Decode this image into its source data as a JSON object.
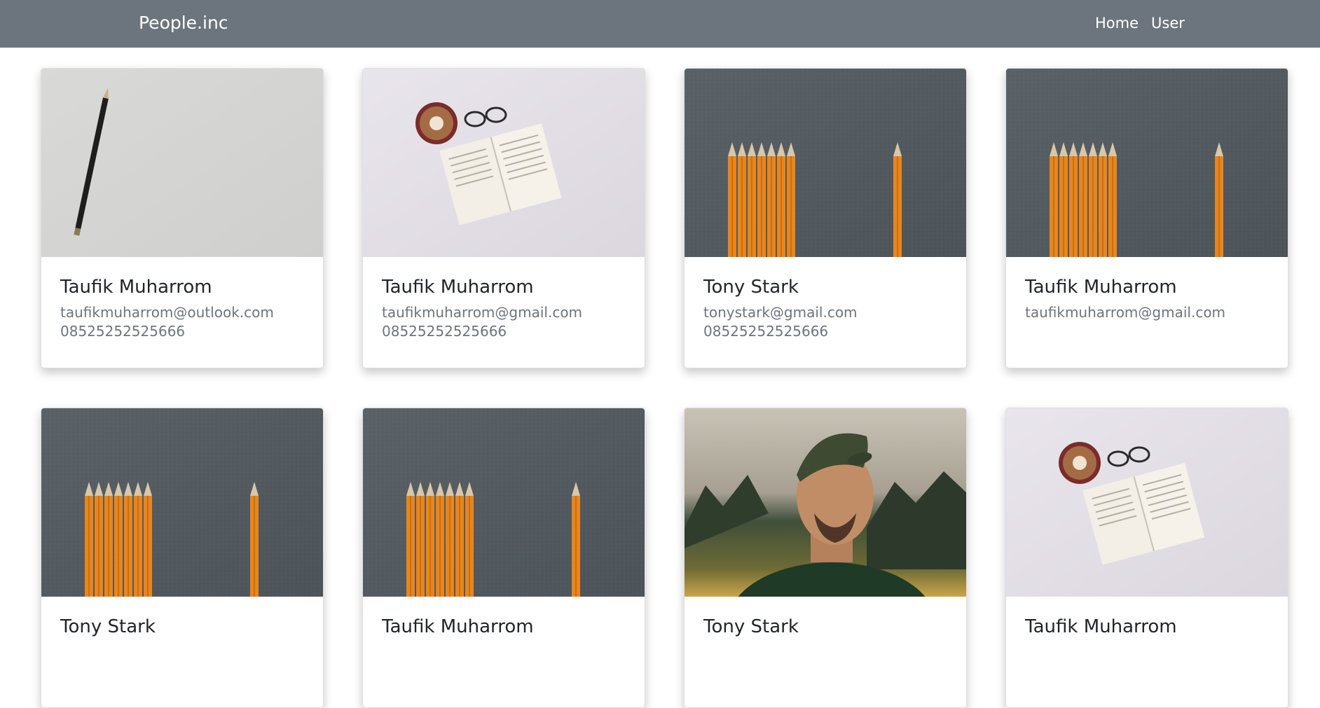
{
  "navbar": {
    "brand": "People.inc",
    "links": [
      "Home",
      "User"
    ]
  },
  "cards": [
    {
      "name": "Taufik Muharrom",
      "email": "taufikmuharrom@outlook.com",
      "phone": "08525252525666",
      "image": "pencil-on-white-photo"
    },
    {
      "name": "Taufik Muharrom",
      "email": "taufikmuharrom@gmail.com",
      "phone": "08525252525666",
      "image": "coffee-book-glasses-photo"
    },
    {
      "name": "Tony Stark",
      "email": "tonystark@gmail.com",
      "phone": "08525252525666",
      "image": "orange-pencils-photo"
    },
    {
      "name": "Taufik Muharrom",
      "email": "taufikmuharrom@gmail.com",
      "phone": "",
      "image": "orange-pencils-photo"
    },
    {
      "name": "Tony Stark",
      "email": "",
      "phone": "",
      "image": "orange-pencils-photo"
    },
    {
      "name": "Taufik Muharrom",
      "email": "",
      "phone": "",
      "image": "orange-pencils-photo"
    },
    {
      "name": "Tony Stark",
      "email": "",
      "phone": "",
      "image": "man-in-cap-photo"
    },
    {
      "name": "Taufik Muharrom",
      "email": "",
      "phone": "",
      "image": "coffee-book-glasses-photo"
    }
  ]
}
